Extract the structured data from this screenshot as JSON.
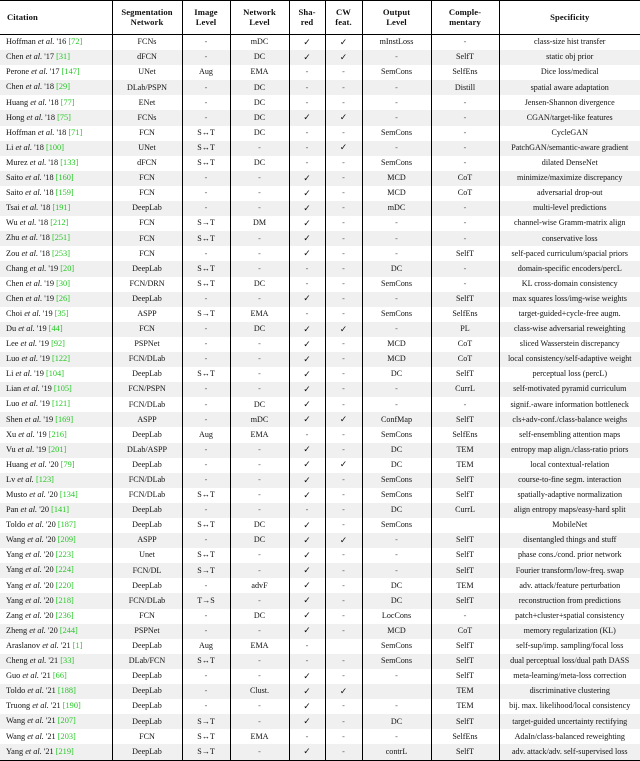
{
  "table": {
    "headers": [
      "Citation",
      "Segmentation Network",
      "Image Level",
      "Network Level",
      "Sha- red",
      "CW feat.",
      "Output Level",
      "Comple- mentary",
      "Specificity"
    ],
    "header_lines": [
      [
        "Citation"
      ],
      [
        "Segmentation",
        "Network"
      ],
      [
        "Image",
        "Level"
      ],
      [
        "Network",
        "Level"
      ],
      [
        "Sha-",
        "red"
      ],
      [
        "CW",
        "feat."
      ],
      [
        "Output",
        "Level"
      ],
      [
        "Comple-",
        "mentary"
      ],
      [
        "Specificity"
      ]
    ],
    "rows": [
      {
        "author": "Hoffman",
        "etal": "et al.",
        "year": "'16",
        "ref": "72",
        "seg": "FCNs",
        "img": "-",
        "net": "mDC",
        "shared": "✓",
        "cw": "✓",
        "out": "mInstLoss",
        "comp": "-",
        "spec": "class-size hist transfer"
      },
      {
        "author": "Chen",
        "etal": "et al.",
        "year": "'17",
        "ref": "31",
        "seg": "dFCN",
        "img": "-",
        "net": "DC",
        "shared": "✓",
        "cw": "✓",
        "out": "-",
        "comp": "SelfT",
        "spec": "static obj prior"
      },
      {
        "author": "Perone",
        "etal": "et al.",
        "year": "'17",
        "ref": "147",
        "seg": "UNet",
        "img": "Aug",
        "net": "EMA",
        "shared": "-",
        "cw": "-",
        "out": "SemCons",
        "comp": "SelfEns",
        "spec": "Dice loss/medical"
      },
      {
        "author": "Chen",
        "etal": "et al.",
        "year": "'18",
        "ref": "29",
        "seg": "DLab/PSPN",
        "img": "-",
        "net": "DC",
        "shared": "-",
        "cw": "-",
        "out": "-",
        "comp": "Distill",
        "spec": "spatial aware adaptation"
      },
      {
        "author": "Huang",
        "etal": "et al.",
        "year": "'18",
        "ref": "77",
        "seg": "ENet",
        "img": "-",
        "net": "DC",
        "shared": "-",
        "cw": "-",
        "out": "-",
        "comp": "-",
        "spec": "Jensen-Shannon divergence"
      },
      {
        "author": "Hong",
        "etal": "et al.",
        "year": "'18",
        "ref": "75",
        "seg": "FCNs",
        "img": "-",
        "net": "DC",
        "shared": "✓",
        "cw": "✓",
        "out": "-",
        "comp": "-",
        "spec": "CGAN/target-like features"
      },
      {
        "author": "Hoffman",
        "etal": "et al.",
        "year": "'18",
        "ref": "71",
        "seg": "FCN",
        "img": "S↔T",
        "net": "DC",
        "shared": "-",
        "cw": "-",
        "out": "SemCons",
        "comp": "-",
        "spec": "CycleGAN"
      },
      {
        "author": "Li",
        "etal": "et al.",
        "year": "'18",
        "ref": "100",
        "seg": "UNet",
        "img": "S↔T",
        "net": "-",
        "shared": "-",
        "cw": "✓",
        "out": "-",
        "comp": "-",
        "spec": "PatchGAN/semantic-aware gradient"
      },
      {
        "author": "Murez",
        "etal": "et al.",
        "year": "'18",
        "ref": "133",
        "seg": "dFCN",
        "img": "S↔T",
        "net": "DC",
        "shared": "-",
        "cw": "-",
        "out": "SemCons",
        "comp": "-",
        "spec": "dilated DenseNet"
      },
      {
        "author": "Saito",
        "etal": "et al.",
        "year": "'18",
        "ref": "160",
        "seg": "FCN",
        "img": "-",
        "net": "-",
        "shared": "✓",
        "cw": "-",
        "out": "MCD",
        "comp": "CoT",
        "spec": "minimize/maximize discrepancy"
      },
      {
        "author": "Saito",
        "etal": "et al.",
        "year": "'18",
        "ref": "159",
        "seg": "FCN",
        "img": "-",
        "net": "-",
        "shared": "✓",
        "cw": "-",
        "out": "MCD",
        "comp": "CoT",
        "spec": "adversarial drop-out"
      },
      {
        "author": "Tsai",
        "etal": "et al.",
        "year": "'18",
        "ref": "191",
        "seg": "DeepLab",
        "img": "-",
        "net": "-",
        "shared": "✓",
        "cw": "-",
        "out": "mDC",
        "comp": "-",
        "spec": "multi-level predictions"
      },
      {
        "author": "Wu",
        "etal": "et al.",
        "year": "'18",
        "ref": "212",
        "seg": "FCN",
        "img": "S→T",
        "net": "DM",
        "shared": "✓",
        "cw": "-",
        "out": "-",
        "comp": "-",
        "spec": "channel-wise Gramm-matrix align"
      },
      {
        "author": "Zhu",
        "etal": "et al.",
        "year": "'18",
        "ref": "251",
        "seg": "FCN",
        "img": "S↔T",
        "net": "-",
        "shared": "✓",
        "cw": "-",
        "out": "-",
        "comp": "-",
        "spec": "conservative loss"
      },
      {
        "author": "Zou",
        "etal": "et al.",
        "year": "'18",
        "ref": "253",
        "seg": "FCN",
        "img": "-",
        "net": "-",
        "shared": "✓",
        "cw": "-",
        "out": "-",
        "comp": "SelfT",
        "spec": "self-paced curriculum/spacial priors"
      },
      {
        "author": "Chang",
        "etal": "et al.",
        "year": "'19",
        "ref": "20",
        "seg": "DeepLab",
        "img": "S↔T",
        "net": "-",
        "shared": "-",
        "cw": "-",
        "out": "DC",
        "comp": "-",
        "spec": "domain-specific encoders/percL"
      },
      {
        "author": "Chen",
        "etal": "et al.",
        "year": "'19",
        "ref": "30",
        "seg": "FCN/DRN",
        "img": "S↔T",
        "net": "DC",
        "shared": "-",
        "cw": "-",
        "out": "SemCons",
        "comp": "-",
        "spec": "KL cross-domain consistency"
      },
      {
        "author": "Chen",
        "etal": "et al.",
        "year": "'19",
        "ref": "26",
        "seg": "DeepLab",
        "img": "-",
        "net": "-",
        "shared": "✓",
        "cw": "-",
        "out": "-",
        "comp": "SelfT",
        "spec": "max squares loss/img-wise weights"
      },
      {
        "author": "Choi",
        "etal": "et al.",
        "year": "'19",
        "ref": "35",
        "seg": "ASPP",
        "img": "S→T",
        "net": "EMA",
        "shared": "-",
        "cw": "-",
        "out": "SemCons",
        "comp": "SelfEns",
        "spec": "target-guided+cycle-free augm."
      },
      {
        "author": "Du",
        "etal": "et al.",
        "year": "'19",
        "ref": "44",
        "seg": "FCN",
        "img": "-",
        "net": "DC",
        "shared": "✓",
        "cw": "✓",
        "out": "-",
        "comp": "PL",
        "spec": "class-wise adversarial reweighting"
      },
      {
        "author": "Lee",
        "etal": "et al.",
        "year": "'19",
        "ref": "92",
        "seg": "PSPNet",
        "img": "-",
        "net": "-",
        "shared": "✓",
        "cw": "-",
        "out": "MCD",
        "comp": "CoT",
        "spec": "sliced Wasserstein discrepancy"
      },
      {
        "author": "Luo",
        "etal": "et al.",
        "year": "'19",
        "ref": "122",
        "seg": "FCN/DLab",
        "img": "-",
        "net": "-",
        "shared": "✓",
        "cw": "-",
        "out": "MCD",
        "comp": "CoT",
        "spec": "local consistency/self-adaptive weight"
      },
      {
        "author": "Li",
        "etal": "et al.",
        "year": "'19",
        "ref": "104",
        "seg": "DeepLab",
        "img": "S↔T",
        "net": "-",
        "shared": "✓",
        "cw": "-",
        "out": "DC",
        "comp": "SelfT",
        "spec": "perceptual loss (percL)"
      },
      {
        "author": "Lian",
        "etal": "et al.",
        "year": "'19",
        "ref": "105",
        "seg": "FCN/PSPN",
        "img": "-",
        "net": "-",
        "shared": "✓",
        "cw": "-",
        "out": "-",
        "comp": "CurrL",
        "spec": "self-motivated pyramid curriculum"
      },
      {
        "author": "Luo",
        "etal": "et al.",
        "year": "'19",
        "ref": "121",
        "seg": "FCN/DLab",
        "img": "-",
        "net": "DC",
        "shared": "✓",
        "cw": "-",
        "out": "-",
        "comp": "-",
        "spec": "signif.-aware information bottleneck"
      },
      {
        "author": "Shen",
        "etal": "et al.",
        "year": "'19",
        "ref": "169",
        "seg": "ASPP",
        "img": "-",
        "net": "mDC",
        "shared": "✓",
        "cw": "✓",
        "out": "ConfMap",
        "comp": "SelfT",
        "spec": "cls+adv-conf./class-balance weighs"
      },
      {
        "author": "Xu",
        "etal": "et al.",
        "year": "'19",
        "ref": "216",
        "seg": "DeepLab",
        "img": "Aug",
        "net": "EMA",
        "shared": "-",
        "cw": "-",
        "out": "SemCons",
        "comp": "SelfEns",
        "spec": "self-ensembling attention maps"
      },
      {
        "author": "Vu",
        "etal": "et al.",
        "year": "'19",
        "ref": "201",
        "seg": "DLab/ASPP",
        "img": "-",
        "net": "-",
        "shared": "✓",
        "cw": "-",
        "out": "DC",
        "comp": "TEM",
        "spec": "entropy map align./class-ratio priors"
      },
      {
        "author": "Huang",
        "etal": "et al.",
        "year": "'20",
        "ref": "79",
        "seg": "DeepLab",
        "img": "-",
        "net": "-",
        "shared": "✓",
        "cw": "✓",
        "out": "DC",
        "comp": "TEM",
        "spec": "local contextual-relation"
      },
      {
        "author": "Lv",
        "etal": "et al.",
        "year": "",
        "ref": "123",
        "seg": "FCN/DLab",
        "img": "-",
        "net": "-",
        "shared": "✓",
        "cw": "-",
        "out": "SemCons",
        "comp": "SelfT",
        "spec": "course-to-fine segm. interaction"
      },
      {
        "author": "Musto",
        "etal": "et al.",
        "year": "'20",
        "ref": "134",
        "seg": "FCN/DLab",
        "img": "S↔T",
        "net": "-",
        "shared": "✓",
        "cw": "-",
        "out": "SemCons",
        "comp": "SelfT",
        "spec": "spatially-adaptive normalization"
      },
      {
        "author": "Pan",
        "etal": "et al.",
        "year": "'20",
        "ref": "141",
        "seg": "DeepLab",
        "img": "-",
        "net": "-",
        "shared": "-",
        "cw": "-",
        "out": "DC",
        "comp": "CurrL",
        "spec": "align entropy maps/easy-hard split"
      },
      {
        "author": "Toldo",
        "etal": "et al.",
        "year": "'20",
        "ref": "187",
        "seg": "DeepLab",
        "img": "S↔T",
        "net": "DC",
        "shared": "✓",
        "cw": "-",
        "out": "SemCons",
        "comp": "",
        "spec": "MobileNet"
      },
      {
        "author": "Wang",
        "etal": "et al.",
        "year": "'20",
        "ref": "209",
        "seg": "ASPP",
        "img": "-",
        "net": "DC",
        "shared": "✓",
        "cw": "✓",
        "out": "-",
        "comp": "SelfT",
        "spec": "disentangled things and stuff"
      },
      {
        "author": "Yang",
        "etal": "et al.",
        "year": "'20",
        "ref": "223",
        "seg": "Unet",
        "img": "S↔T",
        "net": "-",
        "shared": "✓",
        "cw": "-",
        "out": "-",
        "comp": "SelfT",
        "spec": "phase cons./cond. prior network"
      },
      {
        "author": "Yang",
        "etal": "et al.",
        "year": "'20",
        "ref": "224",
        "seg": "FCN/DL",
        "img": "S→T",
        "net": "-",
        "shared": "✓",
        "cw": "-",
        "out": "-",
        "comp": "SelfT",
        "spec": "Fourier transform/low-freq. swap"
      },
      {
        "author": "Yang",
        "etal": "et al.",
        "year": "'20",
        "ref": "220",
        "seg": "DeepLab",
        "img": "-",
        "net": "advF",
        "shared": "✓",
        "cw": "-",
        "out": "DC",
        "comp": "TEM",
        "spec": "adv. attack/feature perturbation"
      },
      {
        "author": "Yang",
        "etal": "et al.",
        "year": "'20",
        "ref": "218",
        "seg": "FCN/DLab",
        "img": "T→S",
        "net": "-",
        "shared": "✓",
        "cw": "-",
        "out": "DC",
        "comp": "SelfT",
        "spec": "reconstruction from predictions"
      },
      {
        "author": "Zang",
        "etal": "et al.",
        "year": "'20",
        "ref": "236",
        "seg": "FCN",
        "img": "-",
        "net": "DC",
        "shared": "✓",
        "cw": "-",
        "out": "LocCons",
        "comp": "-",
        "spec": "patch+cluster+spatial consistency"
      },
      {
        "author": "Zheng",
        "etal": "et al.",
        "year": "'20",
        "ref": "244",
        "seg": "PSPNet",
        "img": "-",
        "net": "-",
        "shared": "✓",
        "cw": "-",
        "out": "MCD",
        "comp": "CoT",
        "spec": "memory regularization (KL)"
      },
      {
        "author": "Araslanov",
        "etal": "et al.",
        "year": "'21",
        "ref": "1",
        "seg": "DeepLab",
        "img": "Aug",
        "net": "EMA",
        "shared": "-",
        "cw": "",
        "out": "SemCons",
        "comp": "SelfT",
        "spec": "self-sup/imp. sampling/focal loss"
      },
      {
        "author": "Cheng",
        "etal": "et al.",
        "year": "'21",
        "ref": "33",
        "seg": "DLab/FCN",
        "img": "S↔T",
        "net": "-",
        "shared": "-",
        "cw": "-",
        "out": "SemCons",
        "comp": "SelfT",
        "spec": "dual perceptual loss/dual path DASS"
      },
      {
        "author": "Guo",
        "etal": "et al.",
        "year": "'21",
        "ref": "66",
        "seg": "DeepLab",
        "img": "-",
        "net": "-",
        "shared": "✓",
        "cw": "-",
        "out": "-",
        "comp": "SelfT",
        "spec": "meta-learning/meta-loss correction"
      },
      {
        "author": "Toldo",
        "etal": "et al.",
        "year": "'21",
        "ref": "188",
        "seg": "DeepLab",
        "img": "-",
        "net": "Clust.",
        "shared": "✓",
        "cw": "✓",
        "out": "",
        "comp": "TEM",
        "spec": "discriminative clustering"
      },
      {
        "author": "Truong",
        "etal": "et al.",
        "year": "'21",
        "ref": "190",
        "seg": "DeepLab",
        "img": "-",
        "net": "-",
        "shared": "✓",
        "cw": "-",
        "out": "-",
        "comp": "TEM",
        "spec": "bij. max. likelihood/local consistency"
      },
      {
        "author": "Wang",
        "etal": "et al.",
        "year": "'21",
        "ref": "207",
        "seg": "DeepLab",
        "img": "S→T",
        "net": "-",
        "shared": "✓",
        "cw": "-",
        "out": "DC",
        "comp": "SelfT",
        "spec": "target-guided uncertainty rectifying"
      },
      {
        "author": "Wang",
        "etal": "et al.",
        "year": "'21",
        "ref": "203",
        "seg": "FCN",
        "img": "S↔T",
        "net": "EMA",
        "shared": "-",
        "cw": "-",
        "out": "-",
        "comp": "SelfEns",
        "spec": "AdaIn/class-balanced reweighting"
      },
      {
        "author": "Yang",
        "etal": "et al.",
        "year": "'21",
        "ref": "219",
        "seg": "DeepLab",
        "img": "S→T",
        "net": "-",
        "shared": "✓",
        "cw": "-",
        "out": "contrL",
        "comp": "SelfT",
        "spec": "adv. attack/adv. self-supervised loss"
      }
    ]
  },
  "colors": {
    "reference_link": "#23c723",
    "rule": "#000000",
    "zebra_row": "#f0f0f0",
    "text": "#111111"
  }
}
